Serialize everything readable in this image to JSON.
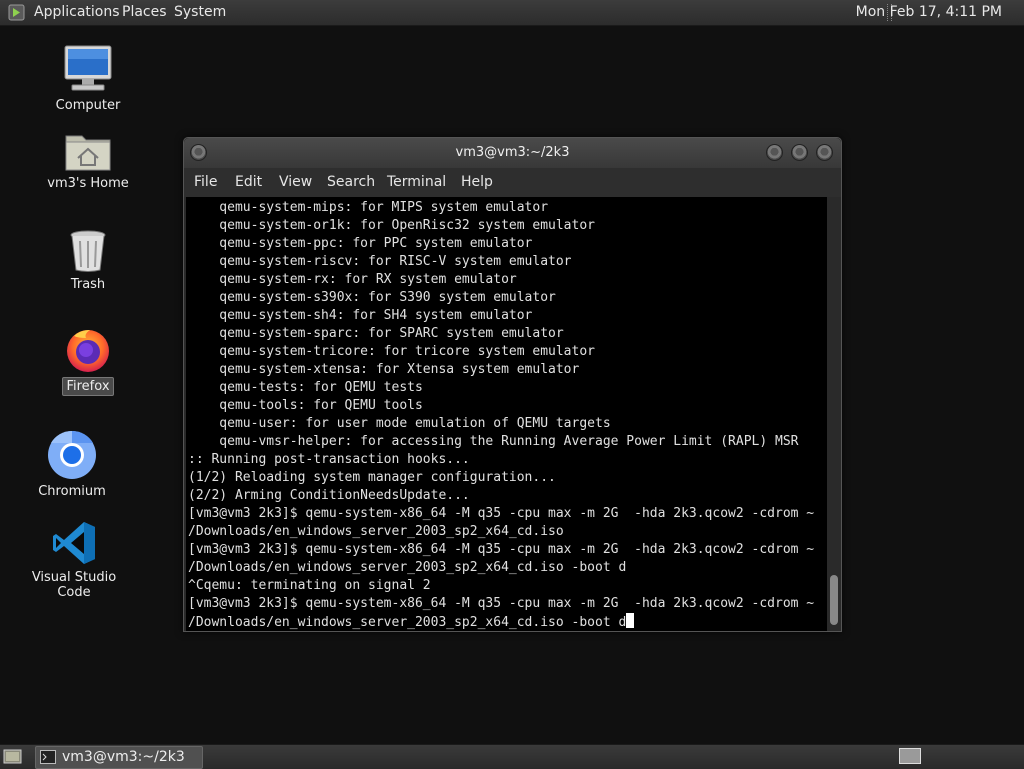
{
  "top_panel": {
    "menus": [
      "Applications",
      "Places",
      "System"
    ],
    "clock": "Mon Feb 17,  4:11 PM"
  },
  "desktop_icons": [
    {
      "label": "Computer",
      "icon": "computer-icon"
    },
    {
      "label": "vm3's Home",
      "icon": "home-folder-icon"
    },
    {
      "label": "Trash",
      "icon": "trash-icon"
    },
    {
      "label": "Firefox",
      "icon": "firefox-icon",
      "selected": true
    },
    {
      "label": "Chromium",
      "icon": "chromium-icon"
    },
    {
      "label": "Visual Studio Code",
      "icon": "vscode-icon"
    }
  ],
  "terminal": {
    "title": "vm3@vm3:~/2k3",
    "menus": [
      "File",
      "Edit",
      "View",
      "Search",
      "Terminal",
      "Help"
    ],
    "lines": [
      "    qemu-system-mips: for MIPS system emulator",
      "    qemu-system-or1k: for OpenRisc32 system emulator",
      "    qemu-system-ppc: for PPC system emulator",
      "    qemu-system-riscv: for RISC-V system emulator",
      "    qemu-system-rx: for RX system emulator",
      "    qemu-system-s390x: for S390 system emulator",
      "    qemu-system-sh4: for SH4 system emulator",
      "    qemu-system-sparc: for SPARC system emulator",
      "    qemu-system-tricore: for tricore system emulator",
      "    qemu-system-xtensa: for Xtensa system emulator",
      "    qemu-tests: for QEMU tests",
      "    qemu-tools: for QEMU tools",
      "    qemu-user: for user mode emulation of QEMU targets",
      "    qemu-vmsr-helper: for accessing the Running Average Power Limit (RAPL) MSR",
      ":: Running post-transaction hooks...",
      "(1/2) Reloading system manager configuration...",
      "(2/2) Arming ConditionNeedsUpdate...",
      "[vm3@vm3 2k3]$ qemu-system-x86_64 -M q35 -cpu max -m 2G  -hda 2k3.qcow2 -cdrom ~",
      "/Downloads/en_windows_server_2003_sp2_x64_cd.iso",
      "[vm3@vm3 2k3]$ qemu-system-x86_64 -M q35 -cpu max -m 2G  -hda 2k3.qcow2 -cdrom ~",
      "/Downloads/en_windows_server_2003_sp2_x64_cd.iso -boot d",
      "^Cqemu: terminating on signal 2",
      "[vm3@vm3 2k3]$ qemu-system-x86_64 -M q35 -cpu max -m 2G  -hda 2k3.qcow2 -cdrom ~",
      "/Downloads/en_windows_server_2003_sp2_x64_cd.iso -boot d"
    ]
  },
  "taskbar": {
    "window_button": "vm3@vm3:~/2k3"
  }
}
